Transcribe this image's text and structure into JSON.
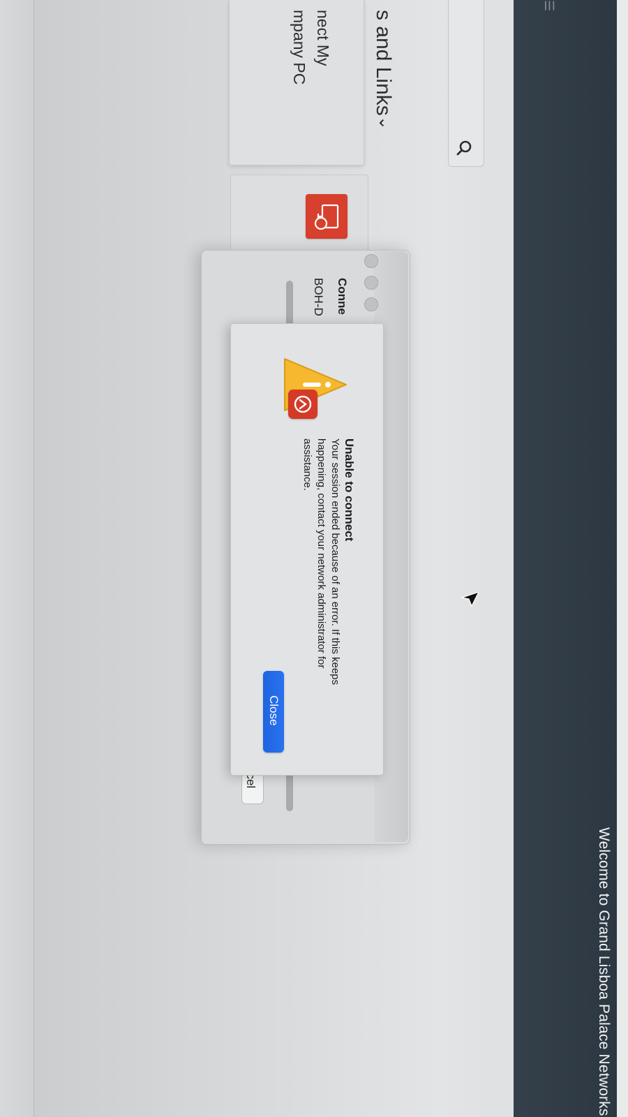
{
  "header": {
    "title": "Welcome to Grand Lisboa Palace Networks",
    "icon": "menu-icon"
  },
  "resources": {
    "section_title": "s and Links",
    "chevron": "⌄",
    "search_icon": "search-icon",
    "cards": [
      {
        "title_line1": "nect My",
        "title_line2": "mpany PC"
      }
    ],
    "app_icon": "remote-desktop-icon"
  },
  "connection_window": {
    "title": "Conne",
    "subtitle": "BOH-D",
    "cancel_label": "ncel"
  },
  "alert": {
    "title": "Unable to connect",
    "message_line1": "Your session ended because of an error. If this keeps",
    "message_line2": "happening, contact your network administrator for",
    "message_line3": "assistance.",
    "close_label": "Close",
    "icon": "warning-icon",
    "badge_icon": "remote-desktop-badge-icon",
    "colors": {
      "button": "#2268E8",
      "warning": "#F5B82E",
      "badge": "#D43A27"
    }
  }
}
